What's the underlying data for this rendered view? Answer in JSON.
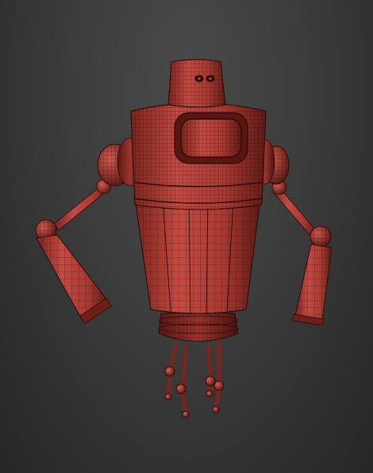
{
  "scene": {
    "subject": "robot-wireframe-model",
    "background_top": "#4a4a4a",
    "background_bottom": "#262626",
    "mesh_fill": "#b8423a",
    "mesh_fill_dark": "#6e1f1a",
    "mesh_fill_light": "#d4635a",
    "wire_color": "#2a0a08"
  }
}
